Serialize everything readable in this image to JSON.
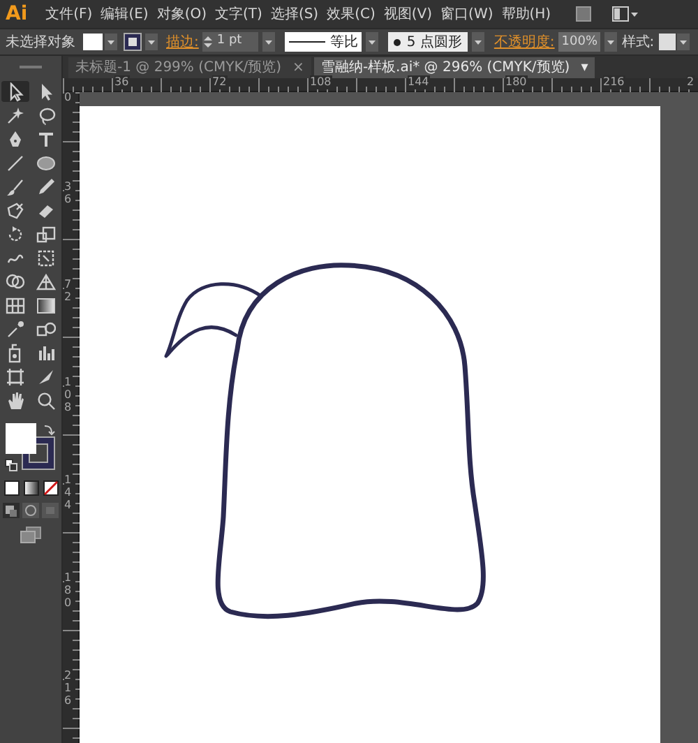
{
  "menu_bar": {
    "logo": "Ai",
    "menus": [
      "文件(F)",
      "编辑(E)",
      "对象(O)",
      "文字(T)",
      "选择(S)",
      "效果(C)",
      "视图(V)",
      "窗口(W)",
      "帮助(H)"
    ]
  },
  "control_bar": {
    "selection": "未选择对象",
    "stroke_label": "描边:",
    "stroke_weight": "1 pt",
    "stroke_profile": "等比",
    "brush": "5 点圆形",
    "opacity_label": "不透明度:",
    "opacity": "100%",
    "style_label": "样式:"
  },
  "tabs": [
    {
      "label": "未标题-1 @ 299% (CMYK/预览)",
      "close": "×",
      "selected": false
    },
    {
      "label": "雪融纳-样板.ai* @ 296% (CMYK/预览)",
      "close": "▾",
      "selected": true
    }
  ],
  "rulers": {
    "horizontal": [
      "36",
      "72",
      "108",
      "144",
      "180",
      "216",
      "2"
    ],
    "vertical": [
      "0",
      "36",
      "72",
      "108",
      "144",
      "180",
      "216"
    ]
  },
  "tools": [
    {
      "selected": true
    },
    {
      "selected": false
    },
    {
      "selected": false
    },
    {
      "selected": false
    },
    {
      "selected": false
    },
    {
      "selected": false
    },
    {
      "selected": false
    },
    {
      "selected": false
    },
    {
      "selected": false
    },
    {
      "selected": false
    },
    {
      "selected": false
    },
    {
      "selected": false
    },
    {
      "selected": false
    },
    {
      "selected": false
    },
    {
      "selected": false
    },
    {
      "selected": false
    },
    {
      "selected": false
    },
    {
      "selected": false
    },
    {
      "selected": false
    },
    {
      "selected": false
    },
    {
      "selected": false
    },
    {
      "selected": false
    },
    {
      "selected": false
    },
    {
      "selected": false
    },
    {
      "selected": false
    },
    {
      "selected": false
    },
    {
      "selected": false
    },
    {
      "selected": false
    }
  ]
}
